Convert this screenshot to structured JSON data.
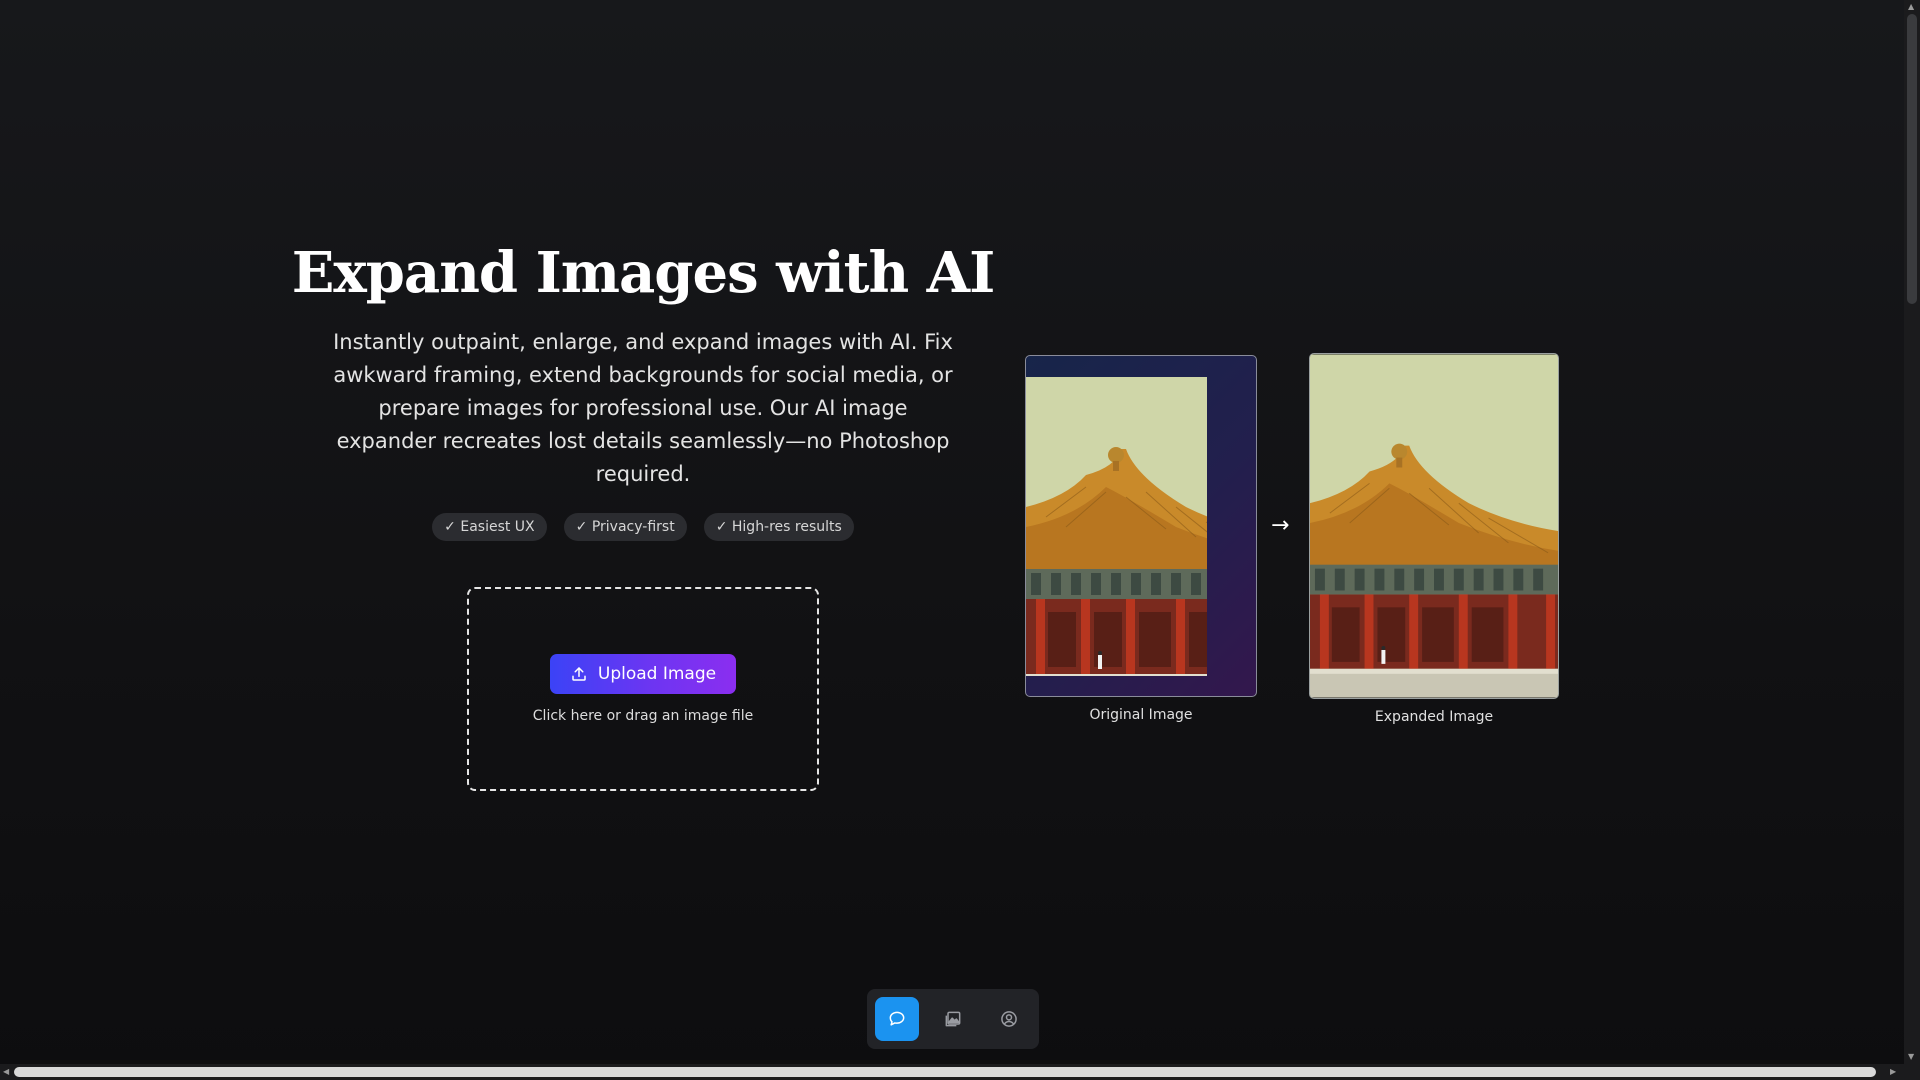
{
  "hero": {
    "title": "Expand Images with AI",
    "description": "Instantly outpaint, enlarge, and expand images with AI. Fix awkward framing, extend backgrounds for social media, or prepare images for professional use. Our AI image expander recreates lost details seamlessly—no Photoshop required.",
    "badges": [
      "✓ Easiest UX",
      "✓ Privacy-first",
      "✓ High-res results"
    ]
  },
  "upload": {
    "button_label": "Upload Image",
    "button_icon": "upload-icon",
    "hint": "Click here or drag an image file"
  },
  "comparison": {
    "original_caption": "Original Image",
    "expanded_caption": "Expanded Image",
    "arrow": "→"
  },
  "bottom_nav": {
    "items": [
      {
        "icon": "chat-bubble-icon",
        "active": true
      },
      {
        "icon": "image-gallery-icon",
        "active": false
      },
      {
        "icon": "user-circle-icon",
        "active": false
      }
    ]
  },
  "colors": {
    "background": "#111114",
    "upload_gradient_start": "#3b43f6",
    "upload_gradient_end": "#8b2ef0",
    "nav_active": "#1b93f0"
  }
}
